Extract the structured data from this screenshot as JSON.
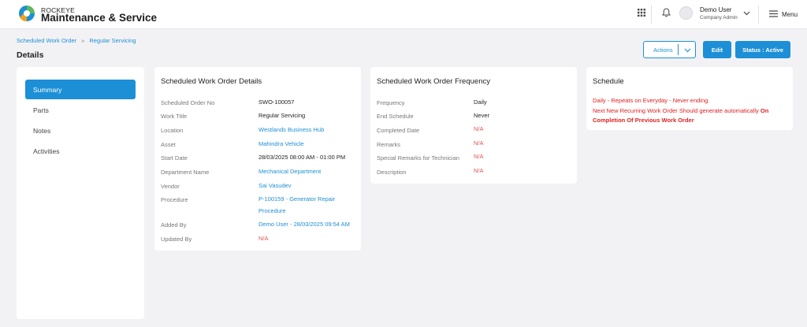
{
  "header": {
    "brand_small": "ROCKEYE",
    "brand_big": "Maintenance & Service",
    "user_name": "Demo User",
    "user_role": "Company Admin",
    "menu_label": "Menu"
  },
  "breadcrumb": {
    "parent": "Scheduled Work Order",
    "current": "Regular Servicing"
  },
  "page": {
    "title": "Details",
    "actions_label": "Actions",
    "edit_label": "Edit",
    "status_label": "Status : Active"
  },
  "sidebar": {
    "items": [
      {
        "label": "Summary"
      },
      {
        "label": "Parts"
      },
      {
        "label": "Notes"
      },
      {
        "label": "Activities"
      }
    ]
  },
  "details": {
    "title": "Scheduled Work Order Details",
    "rows": [
      {
        "label": "Scheduled Order No",
        "value": "SWO-100057"
      },
      {
        "label": "Work Title",
        "value": "Regular Servicing"
      },
      {
        "label": "Location",
        "value": "Westlands Business Hub"
      },
      {
        "label": "Asset",
        "value": "Mahindra Vehicle"
      },
      {
        "label": "Start Date",
        "value": "28/03/2025 08:00 AM - 01:00 PM"
      },
      {
        "label": "Department Name",
        "value": "Mechanical Department"
      },
      {
        "label": "Vendor",
        "value": "Sai Vasudev"
      },
      {
        "label": "Procedure",
        "value": "P-100159 - Generator Repair Procedure"
      },
      {
        "label": "Added By",
        "value": "Demo User - 28/03/2025 09:54 AM"
      },
      {
        "label": "Updated By",
        "value": "N/A"
      }
    ]
  },
  "frequency": {
    "title": "Scheduled Work Order Frequency",
    "rows": [
      {
        "label": "Frequency",
        "value": "Daily"
      },
      {
        "label": "End Schedule",
        "value": "Never"
      },
      {
        "label": "Completed Date",
        "value": "N/A"
      },
      {
        "label": "Remarks",
        "value": "N/A"
      },
      {
        "label": "Special Remarks for Technician",
        "value": "N/A"
      },
      {
        "label": "Description",
        "value": "N/A"
      }
    ]
  },
  "schedule": {
    "title": "Schedule",
    "line1": "Daily - Repeats on Everyday - Never ending.",
    "line2": "Next New Recurring Work Order Should generate automatically",
    "line2_bold": "On",
    "line3_bold": "Completion Of Previous Work Order"
  },
  "colors": {
    "accent": "#1d8fd6",
    "na": "#e05555",
    "schedule_text": "#e02020"
  },
  "icons": [
    "apps-grid-icon",
    "bell-icon",
    "chevron-down-icon",
    "hamburger-menu-icon",
    "breadcrumb-chevron-icon"
  ]
}
